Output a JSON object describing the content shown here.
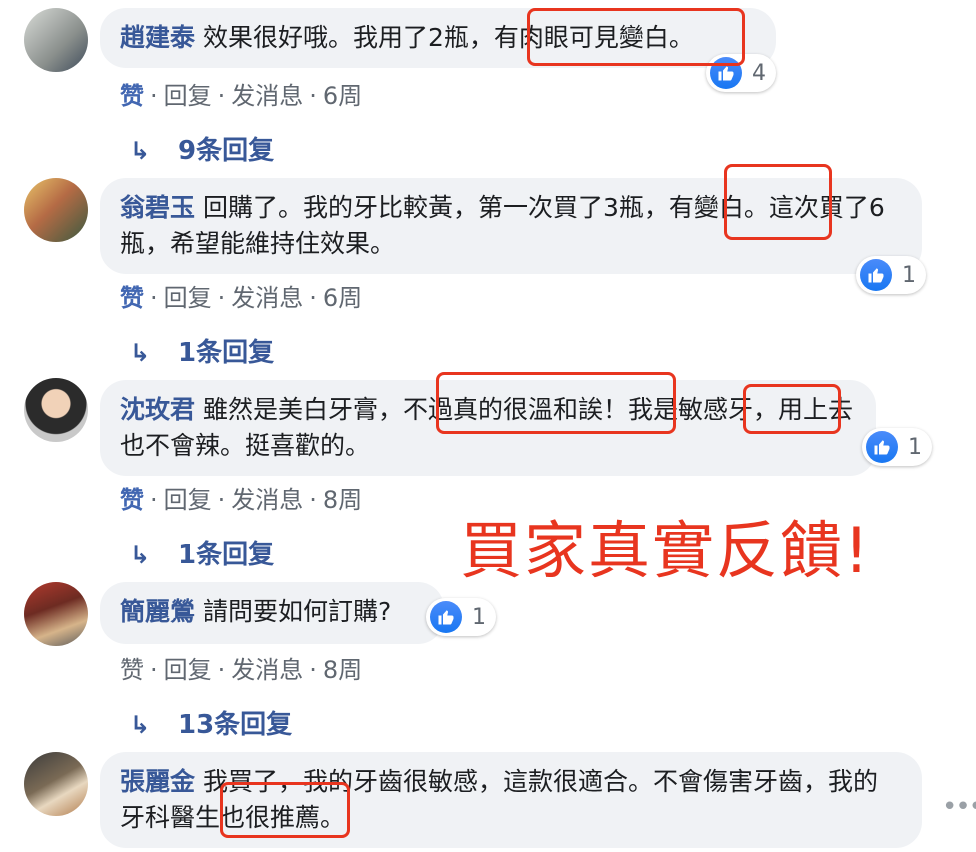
{
  "comments": [
    {
      "name": "趙建泰",
      "text": "效果很好哦。我用了2瓶，有肉眼可見變白。",
      "reactions": "4",
      "actions": {
        "like": "赞",
        "reply": "回复",
        "message": "发消息",
        "time": "6周"
      },
      "replies": "9条回复"
    },
    {
      "name": "翁碧玉",
      "text": "回購了。我的牙比較黃，第一次買了3瓶，有變白。這次買了6瓶，希望能維持住效果。",
      "reactions": "1",
      "actions": {
        "like": "赞",
        "reply": "回复",
        "message": "发消息",
        "time": "6周"
      },
      "replies": "1条回复"
    },
    {
      "name": "沈玫君",
      "text": "雖然是美白牙膏，不過真的很溫和誒！我是敏感牙，用上去也不會辣。挺喜歡的。",
      "reactions": "1",
      "actions": {
        "like": "赞",
        "reply": "回复",
        "message": "发消息",
        "time": "8周"
      },
      "replies": "1条回复"
    },
    {
      "name": "簡麗鶯",
      "text": "請問要如何訂購?",
      "reactions": "1",
      "actions": {
        "like": "赞",
        "reply": "回复",
        "message": "发消息",
        "time": "8周"
      },
      "replies": "13条回复"
    },
    {
      "name": "張麗金",
      "text": "我買了，我的牙齒很敏感，這款很適合。不會傷害牙齒，我的牙科醫生也很推薦。"
    }
  ],
  "banner": "買家真實反饋!",
  "colors": {
    "link": "#385898",
    "highlight": "#e8351f",
    "bubble": "#f0f2f5",
    "like": "#1877f2"
  }
}
